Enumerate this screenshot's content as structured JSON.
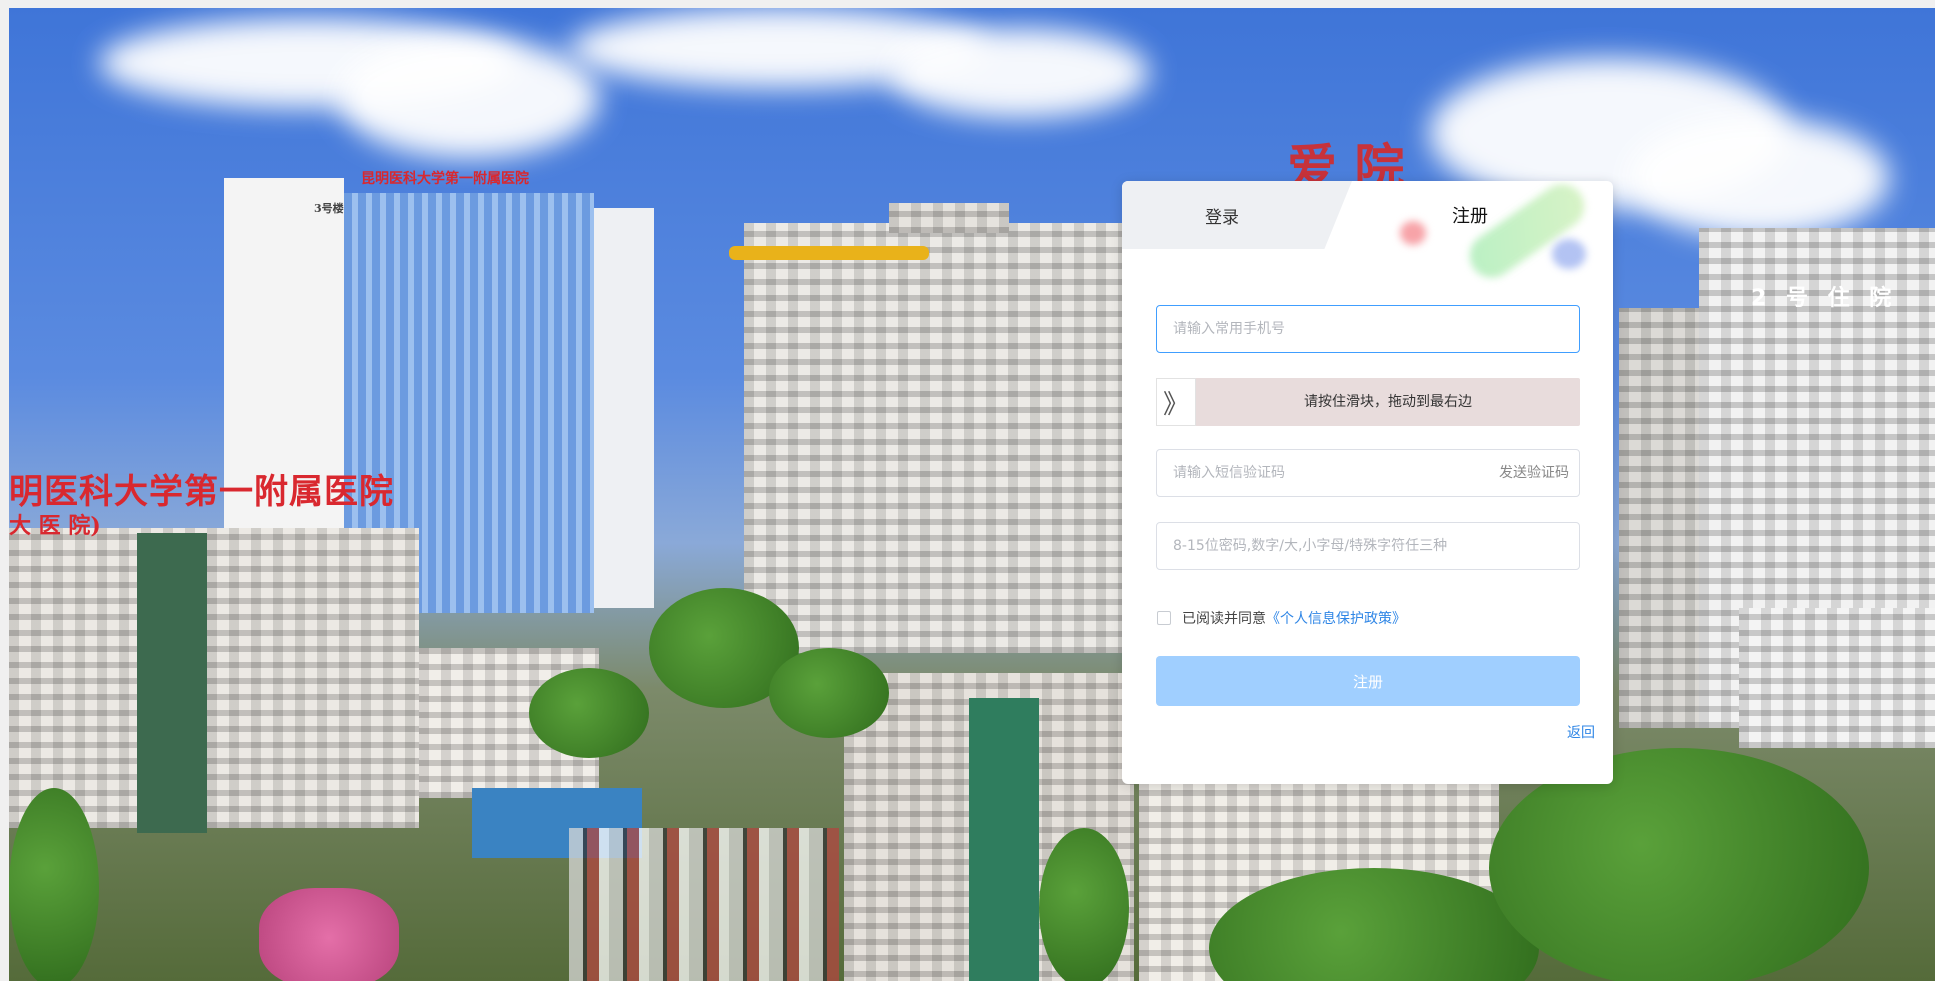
{
  "background": {
    "sign_main": "明医科大学第一附属医院",
    "sign_sub": "大 医 院)",
    "tower_sign": "昆明医科大学第一附属医院",
    "tower_label": "3号楼",
    "right_building_label": "2 号 住 院",
    "calligraphy": "爱 院"
  },
  "tabs": {
    "login": "登录",
    "register": "注册"
  },
  "form": {
    "phone_placeholder": "请输入常用手机号",
    "slider_text": "请按住滑块，拖动到最右边",
    "slider_handle_glyph": "》",
    "sms_placeholder": "请输入短信验证码",
    "send_code": "发送验证码",
    "password_placeholder": "8-15位密码,数字/大,小字母/特殊字符任三种",
    "agree_text": "已阅读并同意",
    "policy_link": "《个人信息保护政策》",
    "register_button": "注册",
    "back_link": "返回"
  },
  "colors": {
    "primary": "#409eff",
    "button_disabled": "#a0cfff",
    "link": "#2f86e6",
    "slider_track": "#e8dcdc"
  }
}
